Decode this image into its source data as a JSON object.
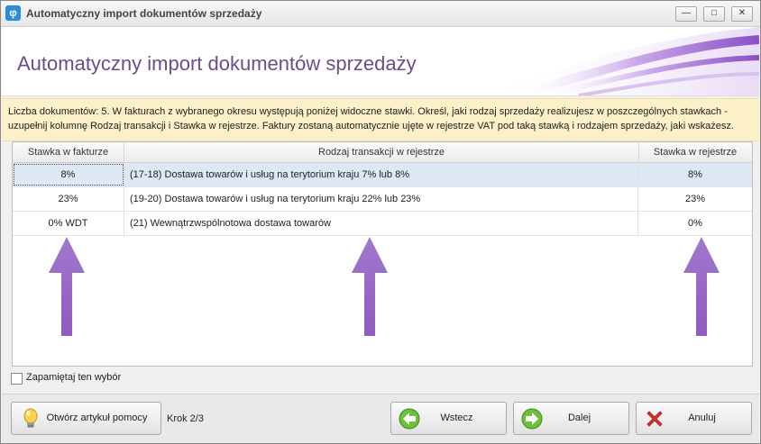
{
  "window": {
    "title": "Automatyczny import dokumentów sprzedaży",
    "controls": {
      "minimize": "—",
      "maximize": "□",
      "close": "✕"
    }
  },
  "header": {
    "title": "Automatyczny import dokumentów sprzedaży"
  },
  "info": {
    "line1": "Liczba dokumentów: 5. W fakturach z wybranego okresu występują poniżej widoczne stawki. Określ, jaki rodzaj sprzedaży realizujesz w poszczególnych stawkach -",
    "line2": "uzupełnij kolumnę Rodzaj transakcji i Stawka w rejestrze. Faktury zostaną automatycznie ujęte w rejestrze VAT pod taką stawką i rodzajem sprzedaży, jaki wskażesz."
  },
  "grid": {
    "columns": [
      "Stawka w fakturze",
      "Rodzaj transakcji w rejestrze",
      "Stawka w rejestrze"
    ],
    "rows": [
      {
        "invoice_rate": "8%",
        "transaction": "(17-18) Dostawa towarów i usług na terytorium kraju 7% lub 8%",
        "register_rate": "8%"
      },
      {
        "invoice_rate": "23%",
        "transaction": "(19-20) Dostawa towarów i usług na terytorium kraju 22% lub 23%",
        "register_rate": "23%"
      },
      {
        "invoice_rate": "0% WDT",
        "transaction": "(21) Wewnątrzwspólnotowa dostawa towarów",
        "register_rate": "0%"
      }
    ]
  },
  "remember": {
    "label": "Zapamiętaj ten wybór",
    "checked": false
  },
  "footer": {
    "help_label": "Otwórz artykuł pomocy",
    "step_label": "Krok 2/3",
    "back_label": "Wstecz",
    "next_label": "Dalej",
    "cancel_label": "Anuluj"
  },
  "icons": {
    "app": "app-icon",
    "help": "lightbulb-icon",
    "back": "arrow-left-icon",
    "next": "arrow-right-icon",
    "cancel": "red-x-icon",
    "annotation": "up-arrow-icon"
  },
  "colors": {
    "accent_purple": "#9a6ec4",
    "header_title": "#6b4d8a",
    "info_bg": "#fbf0c8",
    "selected_row": "#dde7f6"
  }
}
